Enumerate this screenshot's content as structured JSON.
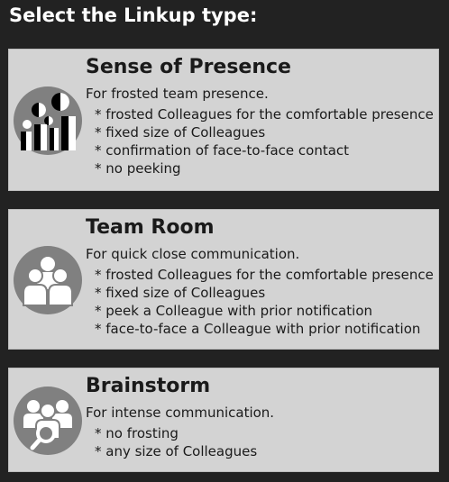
{
  "header": {
    "title": "Select the Linkup type:"
  },
  "colors": {
    "background": "#222222",
    "card": "#d3d3d3",
    "icon": "#808080"
  },
  "options": [
    {
      "title": "Sense of Presence",
      "description": "For frosted team presence.",
      "icon": "presence-icon",
      "features": [
        "* frosted Colleagues for the comfortable presence",
        "* fixed size of Colleagues",
        "* confirmation of face-to-face contact",
        "* no peeking"
      ]
    },
    {
      "title": "Team Room",
      "description": "For quick close communication.",
      "icon": "team-room-icon",
      "features": [
        "* frosted Colleagues for the comfortable presence",
        "* fixed size of Colleagues",
        "* peek a Colleague with prior notification",
        "* face-to-face a Colleague with prior notification"
      ]
    },
    {
      "title": "Brainstorm",
      "description": "For intense communication.",
      "icon": "brainstorm-icon",
      "features": [
        "* no frosting",
        "* any size of Colleagues"
      ]
    }
  ]
}
